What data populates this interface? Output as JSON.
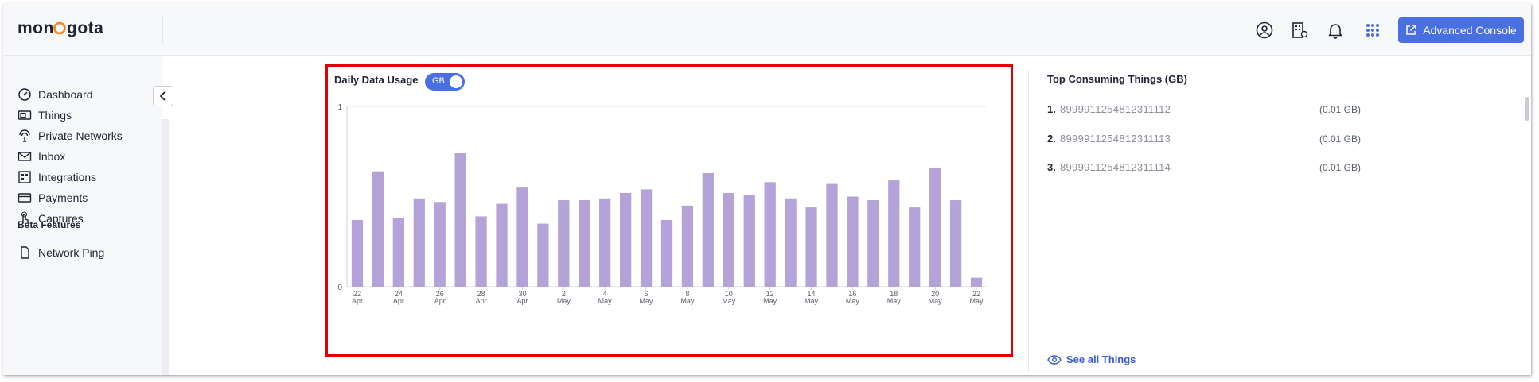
{
  "brand": {
    "logo_text": "monogoto",
    "accent": "#f28c28",
    "primary": "#4a6fe0"
  },
  "header": {
    "icons": [
      "user-circle-icon",
      "account-building-icon",
      "bell-icon",
      "apps-grid-icon"
    ],
    "advanced_console_label": "Advanced Console"
  },
  "sidebar": {
    "items": [
      {
        "label": "Dashboard",
        "icon": "dashboard-icon"
      },
      {
        "label": "Things",
        "icon": "sim-card-icon"
      },
      {
        "label": "Private Networks",
        "icon": "antenna-icon"
      },
      {
        "label": "Inbox",
        "icon": "envelope-icon"
      },
      {
        "label": "Integrations",
        "icon": "integration-icon"
      },
      {
        "label": "Payments",
        "icon": "credit-card-icon"
      },
      {
        "label": "Captures",
        "icon": "touch-icon"
      }
    ],
    "beta_label": "Beta Features",
    "beta_items": [
      {
        "label": "Network Ping",
        "icon": "ping-icon"
      }
    ]
  },
  "usage": {
    "title": "Daily Data Usage",
    "unit_toggle": "GB"
  },
  "chart_data": {
    "type": "bar",
    "title": "Daily Data Usage",
    "ylabel": "",
    "xlabel": "",
    "ylim": [
      0,
      1
    ],
    "yticks": [
      "0",
      "1"
    ],
    "bar_color": "#b3a3d9",
    "categories": [
      "22 Apr",
      "23 Apr",
      "24 Apr",
      "25 Apr",
      "26 Apr",
      "27 Apr",
      "28 Apr",
      "29 Apr",
      "30 Apr",
      "1 May",
      "2 May",
      "3 May",
      "4 May",
      "5 May",
      "6 May",
      "7 May",
      "8 May",
      "9 May",
      "10 May",
      "11 May",
      "12 May",
      "13 May",
      "14 May",
      "15 May",
      "16 May",
      "17 May",
      "18 May",
      "19 May",
      "20 May",
      "21 May",
      "22 May"
    ],
    "values": [
      0.37,
      0.64,
      0.38,
      0.49,
      0.47,
      0.74,
      0.39,
      0.46,
      0.55,
      0.35,
      0.48,
      0.48,
      0.49,
      0.52,
      0.54,
      0.37,
      0.45,
      0.63,
      0.52,
      0.51,
      0.58,
      0.49,
      0.44,
      0.57,
      0.5,
      0.48,
      0.59,
      0.44,
      0.66,
      0.48,
      0.05
    ],
    "tick_labels": [
      {
        "day": "22",
        "month": "Apr"
      },
      {
        "day": "24",
        "month": "Apr"
      },
      {
        "day": "26",
        "month": "Apr"
      },
      {
        "day": "28",
        "month": "Apr"
      },
      {
        "day": "30",
        "month": "Apr"
      },
      {
        "day": "2",
        "month": "May"
      },
      {
        "day": "4",
        "month": "May"
      },
      {
        "day": "6",
        "month": "May"
      },
      {
        "day": "8",
        "month": "May"
      },
      {
        "day": "10",
        "month": "May"
      },
      {
        "day": "12",
        "month": "May"
      },
      {
        "day": "14",
        "month": "May"
      },
      {
        "day": "16",
        "month": "May"
      },
      {
        "day": "18",
        "month": "May"
      },
      {
        "day": "20",
        "month": "May"
      },
      {
        "day": "22",
        "month": "May"
      }
    ]
  },
  "top_consuming": {
    "title": "Top Consuming Things (GB)",
    "items": [
      {
        "rank": "1.",
        "id": "8999911254812311112",
        "value": "(0.01 GB)"
      },
      {
        "rank": "2.",
        "id": "8999911254812311113",
        "value": "(0.01 GB)"
      },
      {
        "rank": "3.",
        "id": "8999911254812311114",
        "value": "(0.01 GB)"
      }
    ],
    "see_all_label": "See all Things"
  }
}
